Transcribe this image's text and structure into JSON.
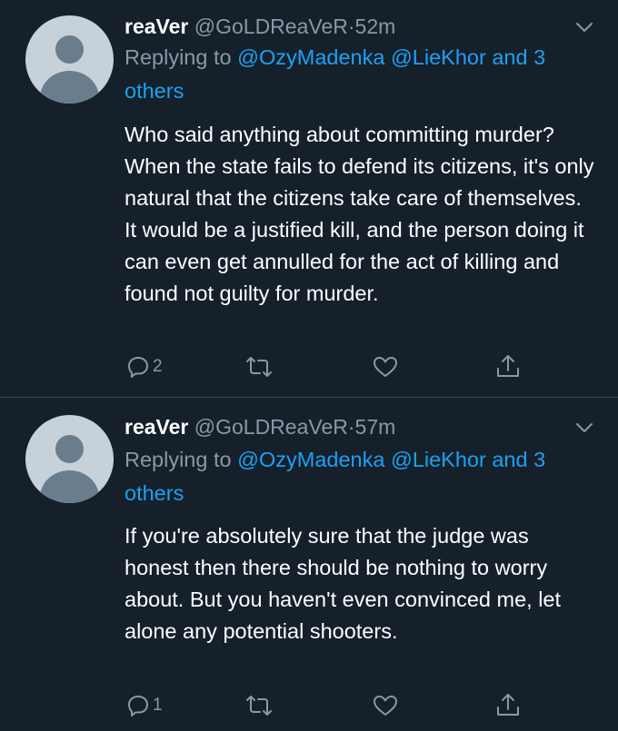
{
  "tweets": [
    {
      "display_name": "reaVer",
      "handle": "@GoLDReaVeR",
      "separator": "·",
      "time": "52m",
      "replying_prefix": "Replying to",
      "mention_1": "@OzyMadenka",
      "mention_2": "@LieKhor",
      "and_text": "and",
      "others": "3 others",
      "text": "Who said anything about committing murder? When the state fails to defend its citizens, it's only natural that the citizens take care of themselves. It would be a justified kill, and the person doing it can even get annulled for the act of killing and found not guilty for murder.",
      "reply_count": "2"
    },
    {
      "display_name": "reaVer",
      "handle": "@GoLDReaVeR",
      "separator": "·",
      "time": "57m",
      "replying_prefix": "Replying to",
      "mention_1": "@OzyMadenka",
      "mention_2": "@LieKhor",
      "and_text": "and",
      "others": "3 others",
      "text": "If you're absolutely sure that the judge was honest then there should be nothing to worry about. But you haven't even convinced me, let alone any potential shooters.",
      "reply_count": "1"
    }
  ],
  "icons": {
    "reply": "reply-icon",
    "retweet": "retweet-icon",
    "like": "heart-icon",
    "share": "share-icon",
    "caret": "chevron-down-icon",
    "avatar": "default-avatar-icon"
  },
  "colors": {
    "background": "#15202b",
    "text_primary": "#ffffff",
    "text_secondary": "#8899a6",
    "link": "#1da1f2",
    "divider": "#38444d",
    "avatar_bg": "#c6d1da",
    "avatar_figure": "#6a7d8c"
  }
}
